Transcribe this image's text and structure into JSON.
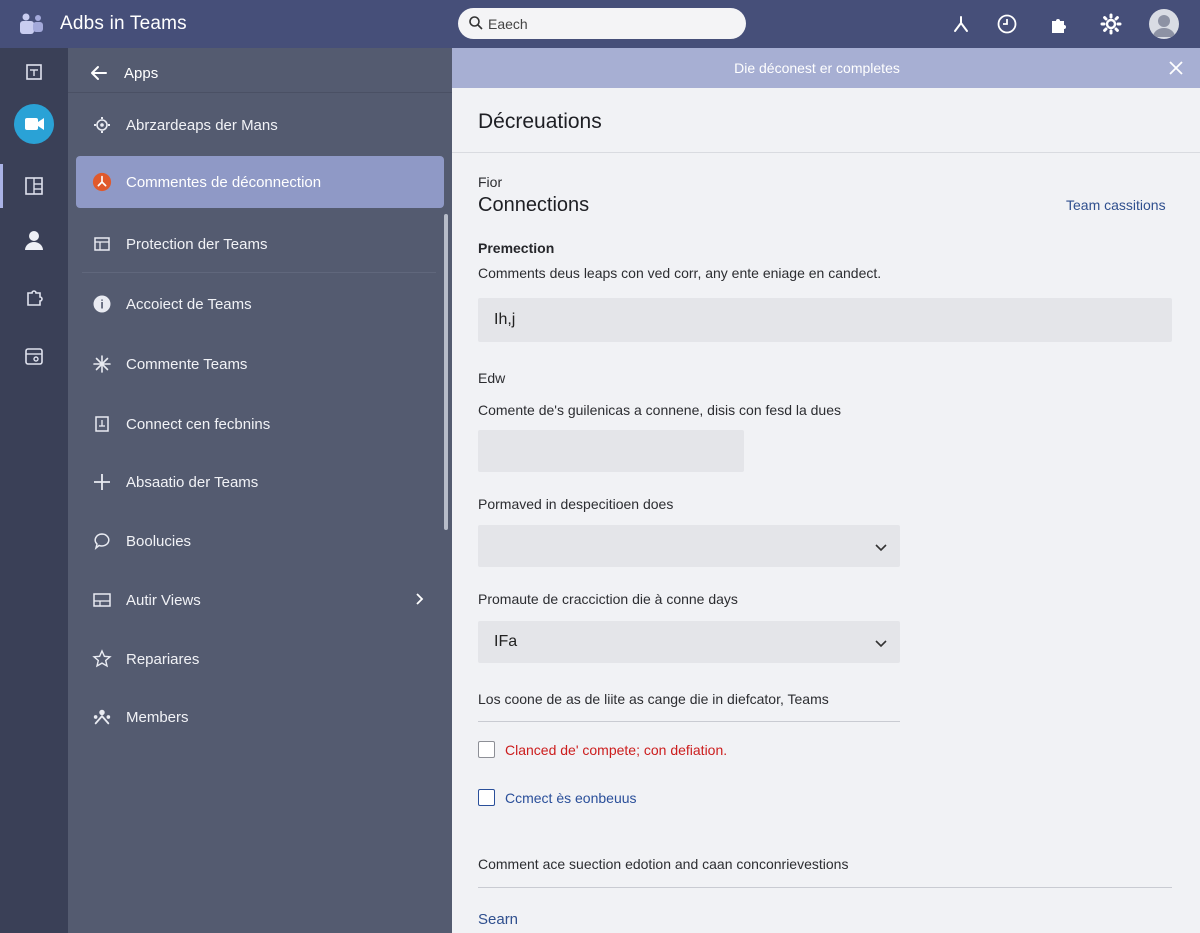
{
  "app": {
    "title": "Adbs in Teams"
  },
  "search": {
    "placeholder": "Eaech"
  },
  "rail": {
    "items": [
      "apps-icon",
      "video-icon",
      "board-icon",
      "person-icon",
      "puzzle-icon",
      "calendar-icon"
    ]
  },
  "sidebar": {
    "back_label": "Apps",
    "items": [
      {
        "label": "Abrzardeaps der Mans",
        "icon": "gear-badge-icon"
      },
      {
        "label": "Commentes de déconnection",
        "icon": "alert-badge-icon",
        "active": true
      },
      {
        "label": "Protection der Teams",
        "icon": "window-icon"
      },
      {
        "label": "Accoiect de Teams",
        "icon": "info-icon"
      },
      {
        "label": "Commente Teams",
        "icon": "sparkle-icon"
      },
      {
        "label": "Connect cen fecbnins",
        "icon": "document-icon"
      },
      {
        "label": "Absaatio der Teams",
        "icon": "plus-icon"
      },
      {
        "label": "Boolucies",
        "icon": "bubble-icon"
      },
      {
        "label": "Autir Views",
        "icon": "layout-icon"
      },
      {
        "label": "Repariares",
        "icon": "star-icon"
      },
      {
        "label": "Members",
        "icon": "members-icon"
      }
    ]
  },
  "banner": {
    "text": "Die déconest er completes"
  },
  "main": {
    "title": "Décreuations",
    "for_label": "Fior",
    "section_title": "Connections",
    "team_link": "Team cassitions",
    "premection_label": "Premection",
    "premection_desc": "Comments deus leaps con ved corr, any ente eniage en candect.",
    "premection_value": "Ih,j",
    "edw_label": "Edw",
    "edw_desc": "Comente de's guilenicas a connene, disis con fesd la dues",
    "edw_value": "",
    "formatted_label": "Pormaved in despecitioen does",
    "formatted_value": "",
    "promaute_label": "Promaute de cracciction die à conne days",
    "promaute_value": "IFa",
    "note": "Los coone de as de liite as cange die in diefcator, Teams",
    "checkbox1_label": "Clanced de' compete; con defiation.",
    "checkbox2_label": "Ccmect ès eonbeuus",
    "footer_note": "Comment ace suection edotion and caan conconrievestions",
    "search_link": "Searn"
  },
  "colors": {
    "topbar": "#464f79",
    "rail": "#3a4057",
    "sidebar": "#545b70",
    "active_item": "#8f99c6",
    "banner": "#a7afd3",
    "link": "#2f4f8e",
    "error": "#cc1d1d"
  }
}
